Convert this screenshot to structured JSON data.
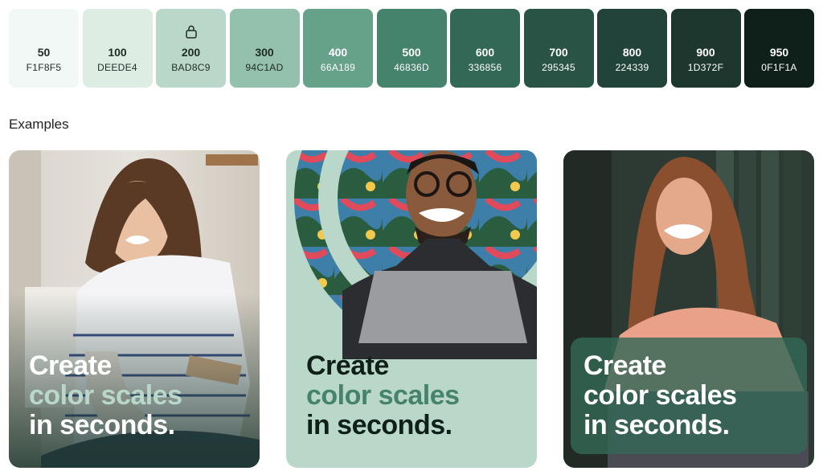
{
  "palette": {
    "swatches": [
      {
        "shade": "50",
        "hex": "F1F8F5",
        "color": "#F1F8F5"
      },
      {
        "shade": "100",
        "hex": "DEEDE4",
        "color": "#DEEDE4"
      },
      {
        "shade": "200",
        "hex": "BAD8C9",
        "color": "#BAD8C9",
        "locked": true
      },
      {
        "shade": "300",
        "hex": "94C1AD",
        "color": "#94C1AD"
      },
      {
        "shade": "400",
        "hex": "66A189",
        "color": "#66A189"
      },
      {
        "shade": "500",
        "hex": "46836D",
        "color": "#46836D"
      },
      {
        "shade": "600",
        "hex": "336856",
        "color": "#336856"
      },
      {
        "shade": "700",
        "hex": "295345",
        "color": "#295345"
      },
      {
        "shade": "800",
        "hex": "224339",
        "color": "#224339"
      },
      {
        "shade": "900",
        "hex": "1D372F",
        "color": "#1D372F"
      },
      {
        "shade": "950",
        "hex": "0F1F1A",
        "color": "#0F1F1A"
      }
    ],
    "lock_icon": "lock-icon"
  },
  "examples": {
    "title": "Examples",
    "cards": [
      {
        "line1": "Create",
        "line2": "color scales",
        "line3": "in seconds."
      },
      {
        "line1": "Create",
        "line2": "color scales",
        "line3": "in seconds."
      },
      {
        "line1": "Create",
        "line2": "color scales",
        "line3": "in seconds."
      }
    ]
  }
}
